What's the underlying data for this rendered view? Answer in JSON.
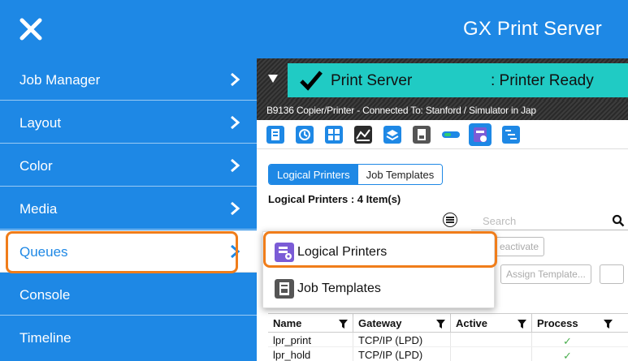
{
  "app": {
    "title": "GX Print Server"
  },
  "sidebar": {
    "items": [
      {
        "label": "Job Manager"
      },
      {
        "label": "Layout"
      },
      {
        "label": "Color"
      },
      {
        "label": "Media"
      },
      {
        "label": "Queues",
        "active": true
      },
      {
        "label": "Console"
      },
      {
        "label": "Timeline"
      }
    ]
  },
  "status": {
    "name": "Print Server",
    "value": ": Printer Ready",
    "color": "#20cbc4"
  },
  "device": {
    "text": "B9136 Copier/Printer - Connected To: Stanford / Simulator in Jap"
  },
  "toolbar_icons": [
    "queue-icon",
    "history-icon",
    "grid-icon",
    "chart-icon",
    "layers-icon",
    "document-icon",
    "toggle-icon",
    "logical-printer-icon",
    "list-icon"
  ],
  "tabs": [
    {
      "label": "Logical Printers",
      "active": true
    },
    {
      "label": "Job Templates",
      "active": false
    }
  ],
  "items_count": "Logical Printers : 4 Item(s)",
  "search": {
    "placeholder": "Search"
  },
  "buttons": {
    "deactivate": "eactivate",
    "assign_template": "Assign Template..."
  },
  "table": {
    "headers": [
      "Name",
      "Gateway",
      "Active",
      "Process"
    ],
    "rows": [
      [
        "lpr_print",
        "TCP/IP (LPD)",
        "",
        "✓"
      ],
      [
        "lpr_hold",
        "TCP/IP (LPD)",
        "",
        "✓"
      ]
    ]
  },
  "dropdown": {
    "items": [
      {
        "label": "Logical Printers",
        "icon": "logical-printer-icon",
        "highlighted": true
      },
      {
        "label": "Job Templates",
        "icon": "job-template-icon",
        "highlighted": false
      }
    ]
  },
  "colors": {
    "brand": "#1e88e5",
    "highlight": "#f07d1a",
    "status_ok": "#20cbc4"
  }
}
